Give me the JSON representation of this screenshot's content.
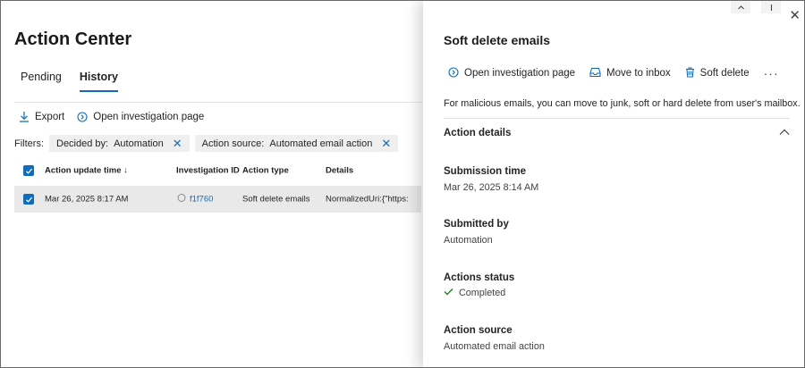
{
  "left": {
    "title": "Action Center",
    "tabs": [
      {
        "label": "Pending",
        "active": false
      },
      {
        "label": "History",
        "active": true
      }
    ],
    "toolbar": {
      "export_label": "Export",
      "open_investigation_label": "Open investigation page"
    },
    "filters": {
      "label": "Filters:",
      "chips": [
        {
          "key": "Decided by:",
          "value": "Automation"
        },
        {
          "key": "Action source:",
          "value": "Automated email action"
        }
      ]
    },
    "table": {
      "columns": [
        "Action update time ↓",
        "Investigation ID",
        "Action type",
        "Details"
      ],
      "rows": [
        {
          "time": "Mar 26, 2025 8:17 AM",
          "investigation_id": "f1f760",
          "action_type": "Soft delete emails",
          "details": "NormalizedUri:{\"https:"
        }
      ]
    }
  },
  "panel": {
    "title": "Soft delete emails",
    "actions": {
      "open_investigation": "Open investigation page",
      "move_to_inbox": "Move to inbox",
      "soft_delete": "Soft delete",
      "more": "···"
    },
    "description": "For malicious emails, you can move to junk, soft or hard delete from user's mailbox.",
    "section_title": "Action details",
    "fields": {
      "submission_time": {
        "label": "Submission time",
        "value": "Mar 26, 2025 8:14 AM"
      },
      "submitted_by": {
        "label": "Submitted by",
        "value": "Automation"
      },
      "actions_status": {
        "label": "Actions status",
        "value": "Completed"
      },
      "action_source": {
        "label": "Action source",
        "value": "Automated email action"
      }
    }
  },
  "colors": {
    "accent": "#0f6cbd",
    "success": "#107c10",
    "row_selected": "#e9e9e9"
  },
  "icons": [
    "download-icon",
    "open-investigation-icon",
    "close-icon",
    "checkbox-icon",
    "circle-status-icon",
    "inbox-icon",
    "trash-icon",
    "chevron-up-icon",
    "checkmark-icon"
  ]
}
